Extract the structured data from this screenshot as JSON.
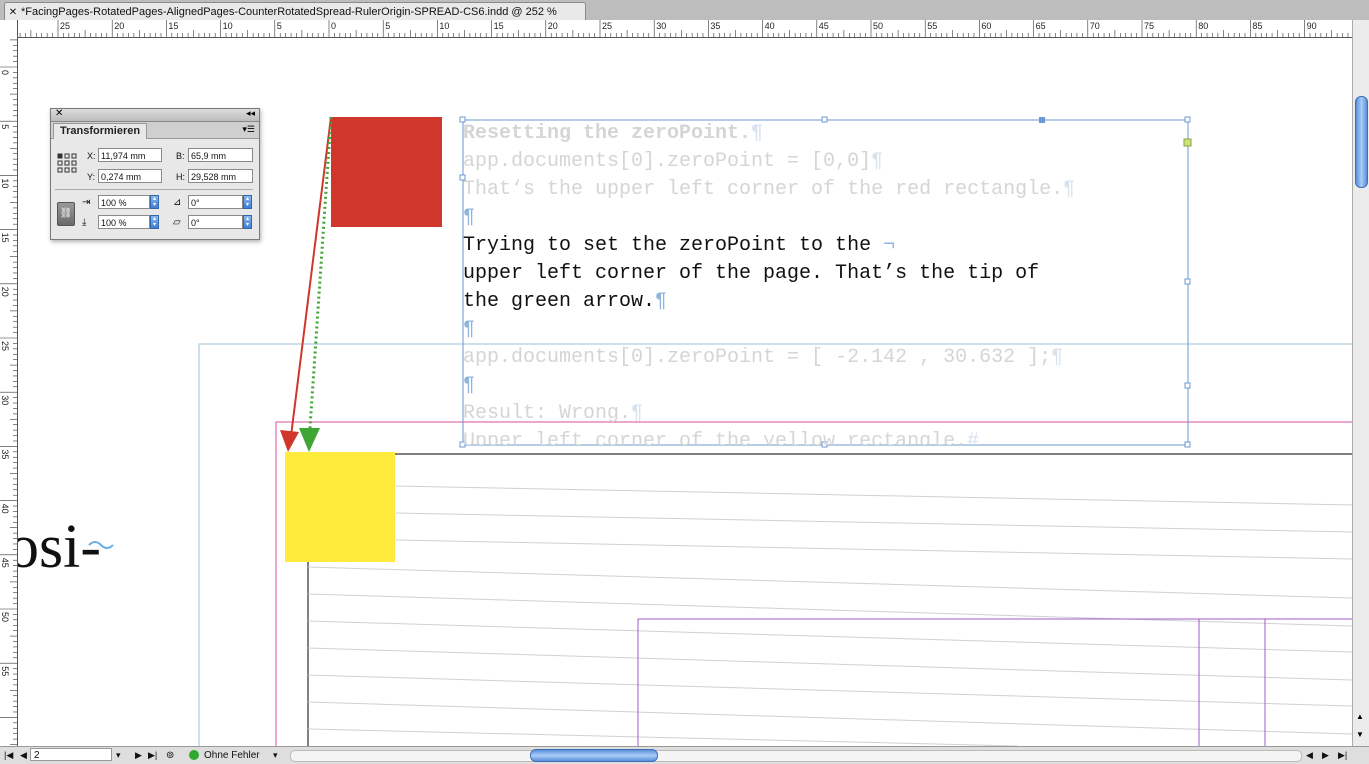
{
  "document": {
    "tab_title": "*FacingPages-RotatedPages-AlignedPages-CounterRotatedSpread-RulerOrigin-SPREAD-CS6.indd @ 252 %"
  },
  "rulers": {
    "horizontal_labels": [
      "25",
      "20",
      "15",
      "10",
      "5",
      "0",
      "5",
      "10",
      "15",
      "20",
      "25",
      "30",
      "35",
      "40",
      "45",
      "50",
      "55",
      "60",
      "65",
      "70",
      "75",
      "80",
      "85",
      "90"
    ],
    "vertical_labels": [
      "5",
      "0",
      "5",
      "10",
      "15",
      "20",
      "25",
      "30",
      "35",
      "40",
      "45",
      "50",
      "55"
    ]
  },
  "text_frame": {
    "lines": [
      "Resetting the zeroPoint.",
      "app.documents[0].zeroPoint = [0,0]",
      "That‘s the upper left corner of the red rectangle.",
      "",
      "Trying to set the zeroPoint to the ",
      "upper left corner of the page. That’s the tip of ",
      "the green arrow.",
      "",
      "app.documents[0].zeroPoint = [ -2.142 , 30.632 ];",
      "",
      "Result: Wrong.",
      "Upper left corner of the yellow rectangle."
    ],
    "pilcrow": "¶",
    "line_break_mark": "¬",
    "end_mark": "#"
  },
  "page_fragment_text": "osi",
  "colors": {
    "red_rect": "#d0362a",
    "yellow_rect": "#ffeb3b",
    "red_arrow": "#d0362a",
    "green_arrow": "#3fa535",
    "frame_blue": "#6a9ad0",
    "margin_magenta": "#d94fa0",
    "column_purple": "#a05bc8"
  },
  "panel": {
    "title": "Transformieren",
    "x_label": "X:",
    "x_value": "11,974 mm",
    "y_label": "Y:",
    "y_value": "0,274 mm",
    "w_label": "B:",
    "w_value": "65,9 mm",
    "h_label": "H:",
    "h_value": "29,528 mm",
    "scale_x": "100 %",
    "scale_y": "100 %",
    "rotation": "0°",
    "shear": "0°",
    "icons": [
      "reference-point-icon",
      "constrain-link-icon",
      "scale-x-icon",
      "scale-y-icon",
      "rotate-icon",
      "shear-icon",
      "panel-menu-icon"
    ]
  },
  "statusbar": {
    "page_number": "2",
    "preflight_status": "Ohne Fehler"
  }
}
